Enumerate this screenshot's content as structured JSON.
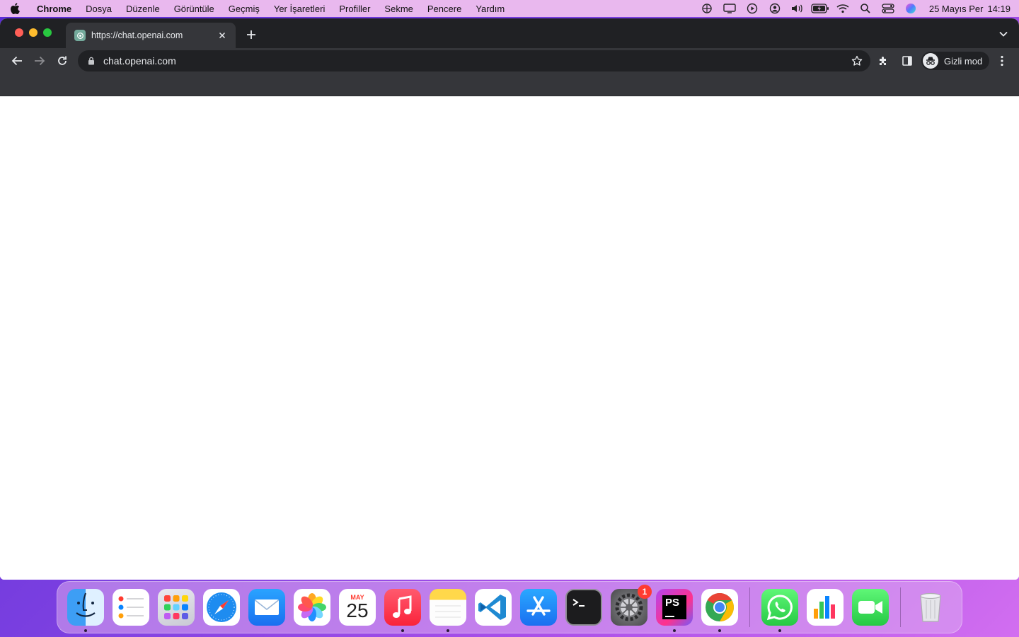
{
  "menubar": {
    "app_name": "Chrome",
    "items": [
      "Dosya",
      "Düzenle",
      "Görüntüle",
      "Geçmiş",
      "Yer İşaretleri",
      "Profiller",
      "Sekme",
      "Pencere",
      "Yardım"
    ],
    "status_icons": [
      "copilot-icon",
      "screen-mirroring-icon",
      "play-icon",
      "user-account-icon",
      "volume-icon",
      "battery-charging-icon",
      "wifi-icon",
      "spotlight-search-icon",
      "control-center-icon",
      "siri-icon"
    ],
    "date": "25 Mayıs Per",
    "time": "14:19"
  },
  "browser": {
    "tab": {
      "title": "https://chat.openai.com",
      "favicon": "openai-icon"
    },
    "address": {
      "url": "chat.openai.com"
    },
    "profile": {
      "label": "Gizli mod",
      "icon": "incognito-icon"
    }
  },
  "dock": {
    "apps": [
      {
        "name": "finder",
        "running": true
      },
      {
        "name": "reminders",
        "running": false
      },
      {
        "name": "launchpad",
        "running": false
      },
      {
        "name": "safari",
        "running": false
      },
      {
        "name": "mail",
        "running": false
      },
      {
        "name": "photos",
        "running": false
      },
      {
        "name": "calendar",
        "running": false,
        "month": "MAY",
        "day": "25"
      },
      {
        "name": "music",
        "running": true
      },
      {
        "name": "notes",
        "running": true
      },
      {
        "name": "vscode",
        "running": false
      },
      {
        "name": "app-store",
        "running": false
      },
      {
        "name": "terminal",
        "running": false
      },
      {
        "name": "system-settings",
        "running": false,
        "badge": "1"
      },
      {
        "name": "phpstorm",
        "running": true,
        "label": "PS"
      },
      {
        "name": "chrome",
        "running": true
      }
    ],
    "recent": [
      {
        "name": "whatsapp",
        "running": true
      },
      {
        "name": "numbers",
        "running": false
      },
      {
        "name": "facetime",
        "running": false
      }
    ],
    "trash": {
      "name": "trash"
    }
  },
  "colors": {
    "menubar_bg": "#e9b8ee",
    "tabstrip_bg": "#202124",
    "toolbar_bg": "#35363a",
    "text_light": "#e8eaed"
  }
}
